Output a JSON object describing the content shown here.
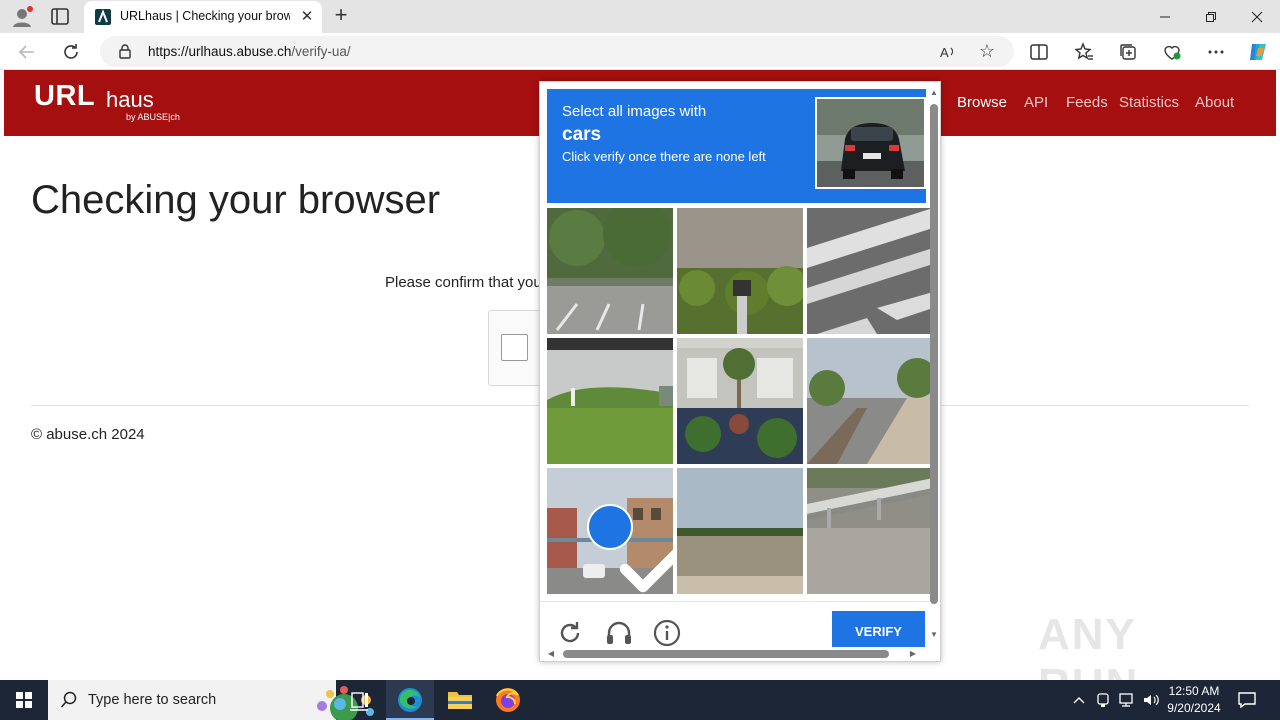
{
  "browser": {
    "tab_title": "URLhaus | Checking your browser",
    "url_domain": "https://urlhaus.abuse.ch",
    "url_path": "/verify-ua/",
    "new_tab_symbol": "+",
    "close_symbol": "✕"
  },
  "site": {
    "logo_url": "URL",
    "logo_haus": "haus",
    "logo_by": "by ABUSE|ch",
    "nav": [
      "Browse",
      "API",
      "Feeds",
      "Statistics",
      "About"
    ],
    "page_title": "Checking your browser",
    "confirm_text": "Please confirm that you are human",
    "copyright": "© abuse.ch 2024"
  },
  "captcha": {
    "prompt_line1": "Select all images with",
    "prompt_target": "cars",
    "prompt_line3": "Click verify once there are none left",
    "verify_label": "VERIFY",
    "tiles": [
      {
        "scene": "parking-trees",
        "selected": false
      },
      {
        "scene": "bushes-wall",
        "selected": false
      },
      {
        "scene": "crosswalk",
        "selected": false
      },
      {
        "scene": "field-hill",
        "selected": false
      },
      {
        "scene": "palm-building",
        "selected": false
      },
      {
        "scene": "road-shrubs",
        "selected": false
      },
      {
        "scene": "street-shops",
        "selected": true
      },
      {
        "scene": "open-field",
        "selected": false
      },
      {
        "scene": "guardrail-road",
        "selected": false
      }
    ]
  },
  "taskbar": {
    "search_placeholder": "Type here to search",
    "time": "12:50 AM",
    "date": "9/20/2024"
  },
  "watermark": "ANY RUN",
  "colors": {
    "brand_red": "#a50f0f",
    "hcaptcha_blue": "#1f74e4",
    "taskbar": "#1c2636"
  }
}
